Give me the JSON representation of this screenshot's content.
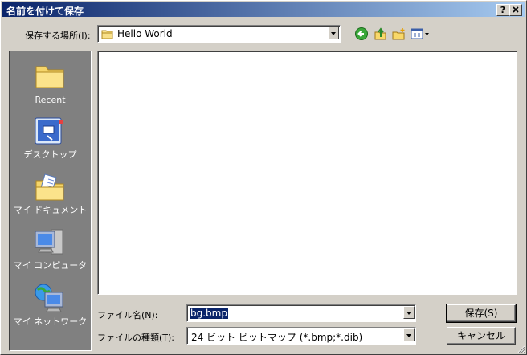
{
  "window": {
    "title": "名前を付けて保存",
    "help_label": "?",
    "close_label": "X"
  },
  "location": {
    "label": "保存する場所(I):",
    "value": "Hello World"
  },
  "toolbar": {
    "icons": [
      "back-icon",
      "up-folder-icon",
      "new-folder-icon",
      "view-menu-icon"
    ]
  },
  "places": [
    {
      "label": "Recent",
      "icon": "recent-folder-icon"
    },
    {
      "label": "デスクトップ",
      "icon": "desktop-icon"
    },
    {
      "label": "マイ ドキュメント",
      "icon": "documents-icon"
    },
    {
      "label": "マイ コンピュータ",
      "icon": "computer-icon"
    },
    {
      "label": "マイ ネットワーク",
      "icon": "network-icon"
    }
  ],
  "filename": {
    "label": "ファイル名(N):",
    "value": "bg.bmp"
  },
  "filetype": {
    "label": "ファイルの種類(T):",
    "value": "24 ビット ビットマップ (*.bmp;*.dib)"
  },
  "buttons": {
    "save": "保存(S)",
    "cancel": "キャンセル"
  }
}
